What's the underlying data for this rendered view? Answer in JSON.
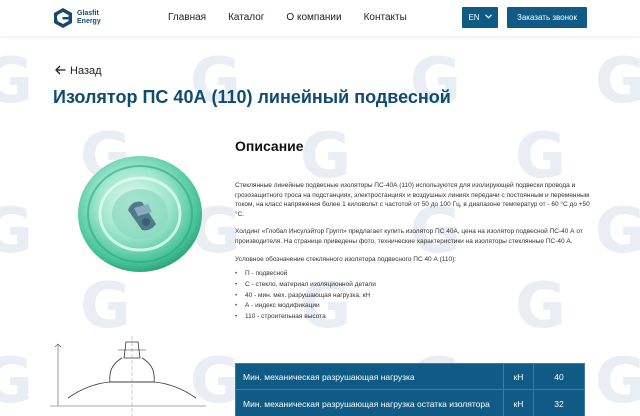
{
  "brand": {
    "logo_line1": "Glasfit",
    "logo_line2": "Energy",
    "watermark": "G",
    "colors": {
      "primary": "#0f5b86",
      "title": "#0f4c72",
      "glass": "#7fd9bf"
    }
  },
  "nav": {
    "items": [
      "Главная",
      "Каталог",
      "О компании",
      "Контакты"
    ],
    "lang": "EN",
    "call_button": "Заказать звонок"
  },
  "page": {
    "back_label": "Назад",
    "title": "Изолятор ПС 40А (110) линейный подвесной"
  },
  "description": {
    "heading": "Описание",
    "paragraphs": [
      "Стеклянные линейные подвесные изоляторы ПС-40А (110) используются для изолирующей подвески провода и грозозащитного троса на подстанциях, электростанциях и воздушных линиях передачи с постоянным и переменным током, на класс напряжения более 1 киловольт с частотой от 50 до 100 Гц, в диапазоне температур от - 60 °С до +50 °С.",
      "Холдинг «Глобал Инсулэйтор Групп» предлагает купить изолятор ПС 40А, цена на изолятор подвесной ПС-40 А от производителя. На странице приведены фото, технические характеристики на изоляторы стеклянные ПС-40 А.",
      "Условное обозначение стеклянного изолятора подвесного ПС 40 А (110):"
    ],
    "list": [
      "П - подвесной",
      "С - стекло, материал изоляционной детали",
      "40 - мин. мех. разрушающая нагрузка, кН",
      "А - индекс модификации",
      "110 - строительная высота"
    ]
  },
  "specs": {
    "rows": [
      {
        "name": "Мин. механическая разрушающая нагрузка",
        "unit": "кН",
        "value": "40"
      },
      {
        "name": "Мин. механическая разрушающая нагрузка остатка изолятора",
        "unit": "кН",
        "value": "32"
      }
    ]
  },
  "icons": {
    "back": "arrow-left-icon",
    "lang_chevron": "chevron-down-icon",
    "logo": "logo-icon"
  }
}
